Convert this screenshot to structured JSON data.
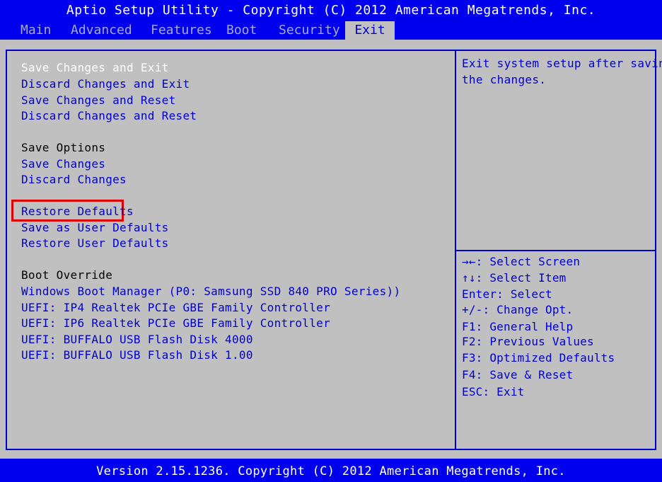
{
  "title": "Aptio Setup Utility - Copyright (C) 2012 American Megatrends, Inc.",
  "tabs": [
    {
      "label": "Main"
    },
    {
      "label": "Advanced"
    },
    {
      "label": "Features"
    },
    {
      "label": "Boot"
    },
    {
      "label": "Security"
    },
    {
      "label": "Exit"
    }
  ],
  "menu": {
    "save_changes_and_exit": "Save Changes and Exit",
    "discard_changes_and_exit": "Discard Changes and Exit",
    "save_changes_and_reset": "Save Changes and Reset",
    "discard_changes_and_reset": "Discard Changes and Reset",
    "save_options_header": "Save Options",
    "save_changes": "Save Changes",
    "discard_changes": "Discard Changes",
    "restore_defaults": "Restore Defaults",
    "save_as_user_defaults": "Save as User Defaults",
    "restore_user_defaults": "Restore User Defaults",
    "boot_override_header": "Boot Override",
    "boot_items": [
      "Windows Boot Manager (P0: Samsung SSD 840 PRO Series))",
      "UEFI: IP4 Realtek PCIe GBE Family Controller",
      "UEFI: IP6 Realtek PCIe GBE Family Controller",
      "UEFI: BUFFALO USB Flash Disk 4000",
      "UEFI: BUFFALO USB Flash Disk 1.00"
    ]
  },
  "help": {
    "line1": "Exit system setup after saving",
    "line2": "the changes."
  },
  "keys": [
    "→←: Select Screen",
    "↑↓: Select Item",
    "Enter: Select",
    "+/-: Change Opt.",
    "F1: General Help",
    "F2: Previous Values",
    "F3: Optimized Defaults",
    "F4: Save & Reset",
    "ESC: Exit"
  ],
  "footer": "Version 2.15.1236. Copyright (C) 2012 American Megatrends, Inc.",
  "colors": {
    "header_bg": "#0000ee",
    "panel_bg": "#c0c0c0",
    "text_blue": "#0000cc",
    "selected_text": "#ffffff",
    "highlight_red": "#e00000"
  }
}
